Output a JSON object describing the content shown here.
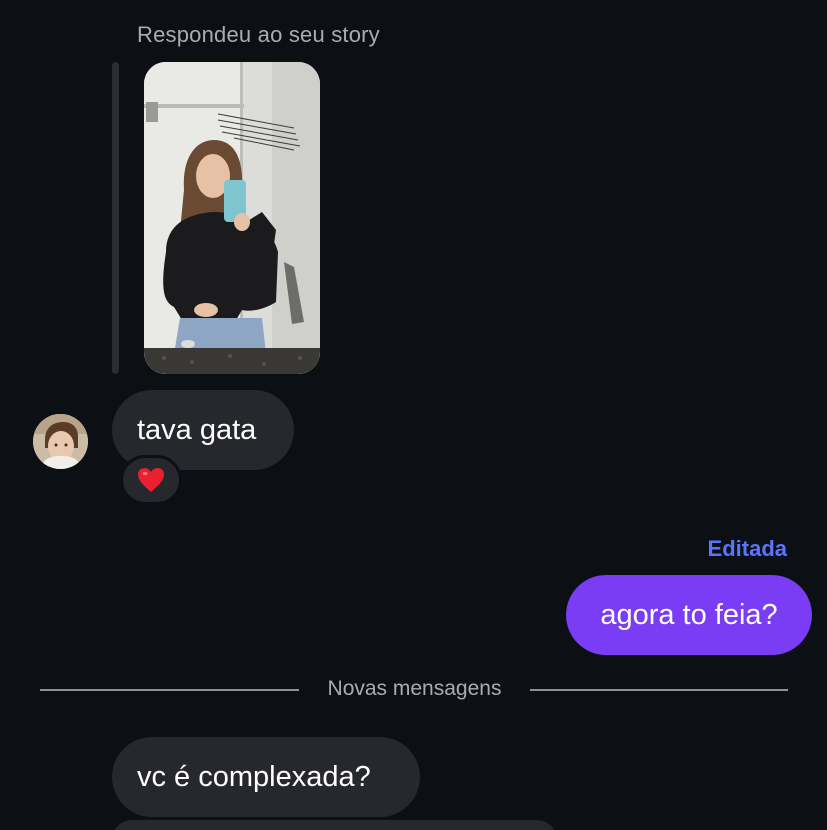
{
  "story_reply": {
    "caption": "Respondeu ao seu story"
  },
  "messages": {
    "incoming_1": "tava gata",
    "incoming_1_reaction": "❤️",
    "outgoing_1": "agora to feia?",
    "outgoing_1_status": "Editada",
    "incoming_2": "vc é complexada?"
  },
  "divider": {
    "label": "Novas mensagens"
  },
  "colors": {
    "background": "#0c0f14",
    "incoming_bubble": "#26282d",
    "outgoing_bubble": "#7a3cf5",
    "edited_label": "#5b74ff"
  }
}
